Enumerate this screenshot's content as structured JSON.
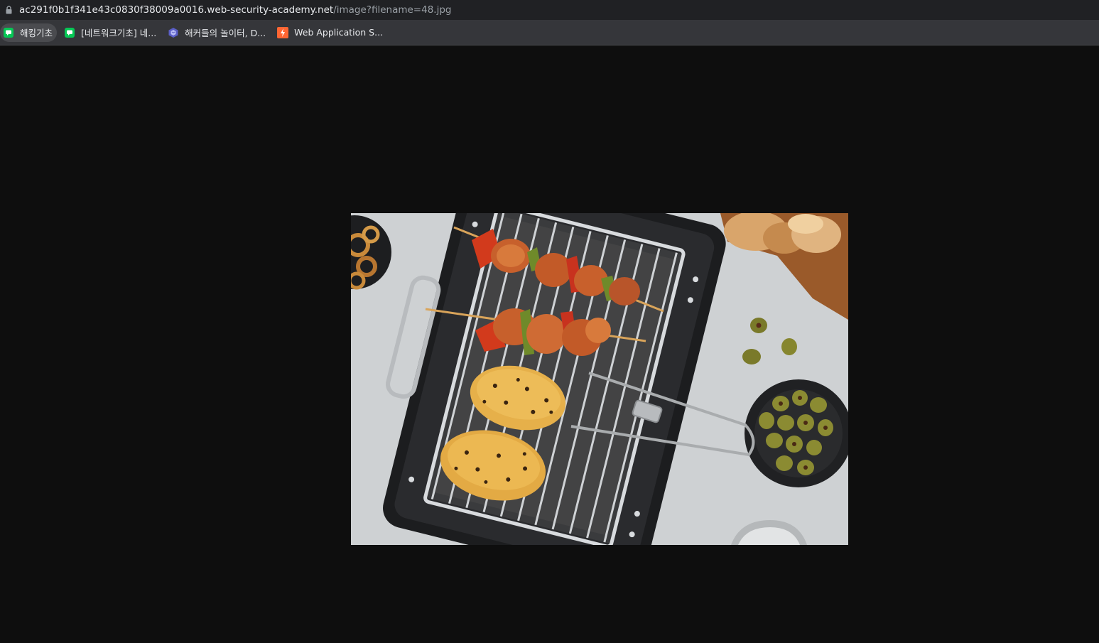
{
  "address_bar": {
    "url_host": "ac291f0b1f341e43c0830f38009a0016.web-security-academy.net",
    "url_path": "/image?filename=48.jpg"
  },
  "bookmarks": [
    {
      "label": "해킹기초",
      "icon": "line-chat-icon",
      "active": true
    },
    {
      "label": "[네트워크기초] 네...",
      "icon": "line-chat-icon",
      "active": false
    },
    {
      "label": "해커들의 놀이터, D...",
      "icon": "dreamhack-icon",
      "active": false
    },
    {
      "label": "Web Application S...",
      "icon": "portswigger-icon",
      "active": false
    }
  ],
  "image": {
    "description_icon": "bbq-grill-photo",
    "colors": {
      "background": "#0e0e0e",
      "table": "#c9cdd0",
      "grill": "#1c1d1f",
      "corn": "#e6b04a",
      "pepper": "#c8321e",
      "olive": "#7a7a2a"
    }
  }
}
